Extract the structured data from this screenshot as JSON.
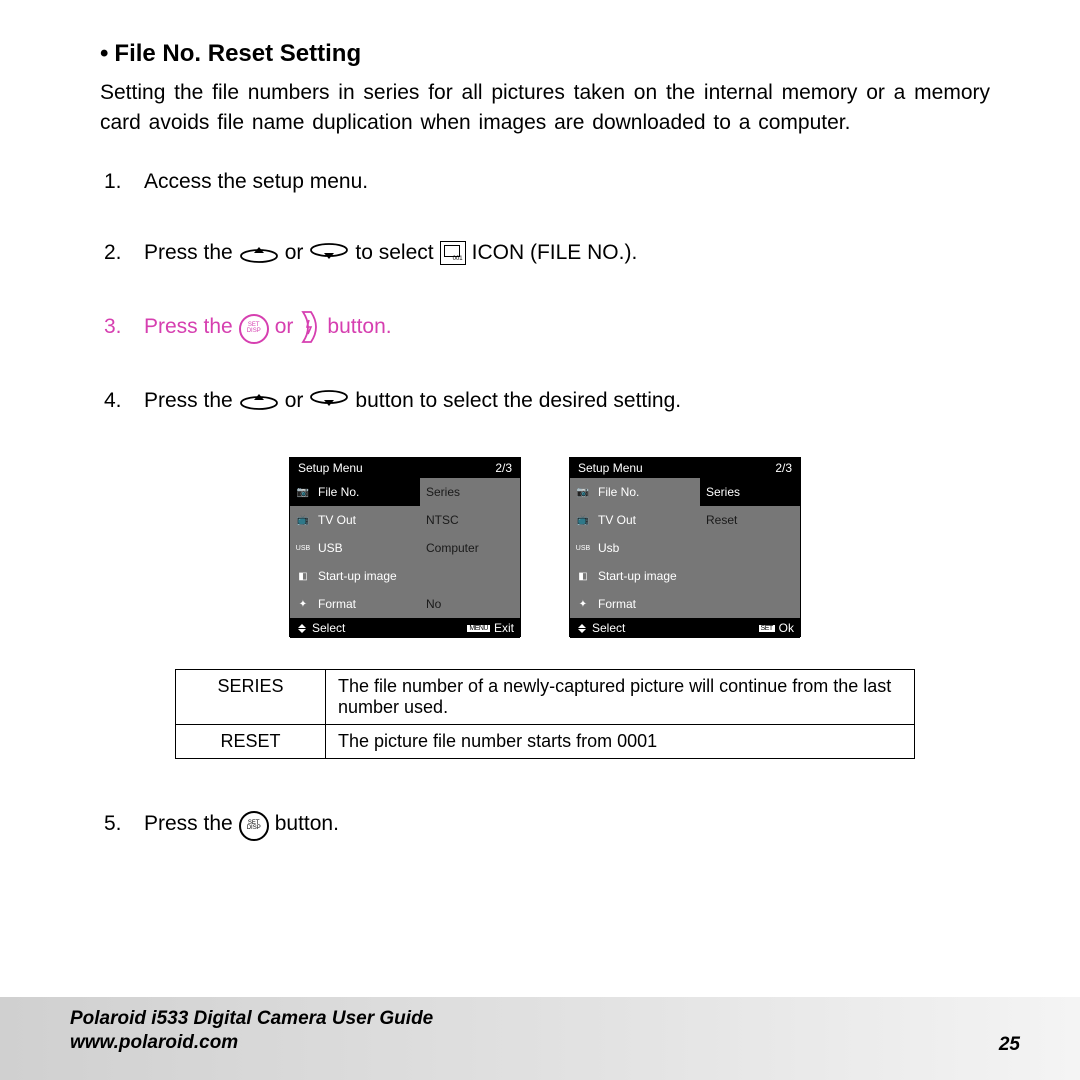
{
  "heading_bullet": "•",
  "heading": "File No. Reset Setting",
  "intro": "Setting the file numbers in series for all pictures taken on the internal memory or a memory card avoids file name duplication when images are downloaded to a computer.",
  "steps": {
    "s1_num": "1.",
    "s1": "Access the setup menu.",
    "s2_num": "2.",
    "s2_a": "Press the",
    "s2_b": "or",
    "s2_c": "to select",
    "s2_d": "ICON (FILE NO.).",
    "s3_num": "3.",
    "s3_a": "Press the",
    "s3_b": "or",
    "s3_c": "button.",
    "s4_num": "4.",
    "s4_a": "Press the",
    "s4_b": "or",
    "s4_c": "button to select the desired setting.",
    "s5_num": "5.",
    "s5_a": "Press the",
    "s5_b": "button."
  },
  "setdisp_top": "SET",
  "setdisp_bot": "DISP",
  "menu_left": {
    "title": "Setup Menu",
    "page": "2/3",
    "rows": [
      {
        "icon": "📷",
        "label": "File No.",
        "value": "Series",
        "selected": true
      },
      {
        "icon": "📺",
        "label": "TV Out",
        "value": "NTSC"
      },
      {
        "icon": "USB",
        "label": "USB",
        "value": "Computer"
      },
      {
        "icon": "◧",
        "label": "Start-up image",
        "value": ""
      },
      {
        "icon": "✦",
        "label": "Format",
        "value": "No"
      }
    ],
    "footer_select": "Select",
    "footer_tag": "MENU",
    "footer_exit": "Exit"
  },
  "menu_right": {
    "title": "Setup Menu",
    "page": "2/3",
    "rows": [
      {
        "icon": "📷",
        "label": "File No.",
        "value": "Series",
        "vsel": true
      },
      {
        "icon": "📺",
        "label": "TV Out",
        "value": "Reset"
      },
      {
        "icon": "USB",
        "label": "Usb",
        "value": ""
      },
      {
        "icon": "◧",
        "label": "Start-up image",
        "value": ""
      },
      {
        "icon": "✦",
        "label": "Format",
        "value": ""
      }
    ],
    "footer_select": "Select",
    "footer_tag": "SET",
    "footer_ok": "Ok"
  },
  "table": {
    "r1_key": "SERIES",
    "r1_val": "The file number of a newly-captured picture will continue from the last number used.",
    "r2_key": "RESET",
    "r2_val": "The picture file number starts from 0001"
  },
  "footer_title": "Polaroid i533 Digital Camera User Guide",
  "footer_url": "www.polaroid.com",
  "page_number": "25"
}
